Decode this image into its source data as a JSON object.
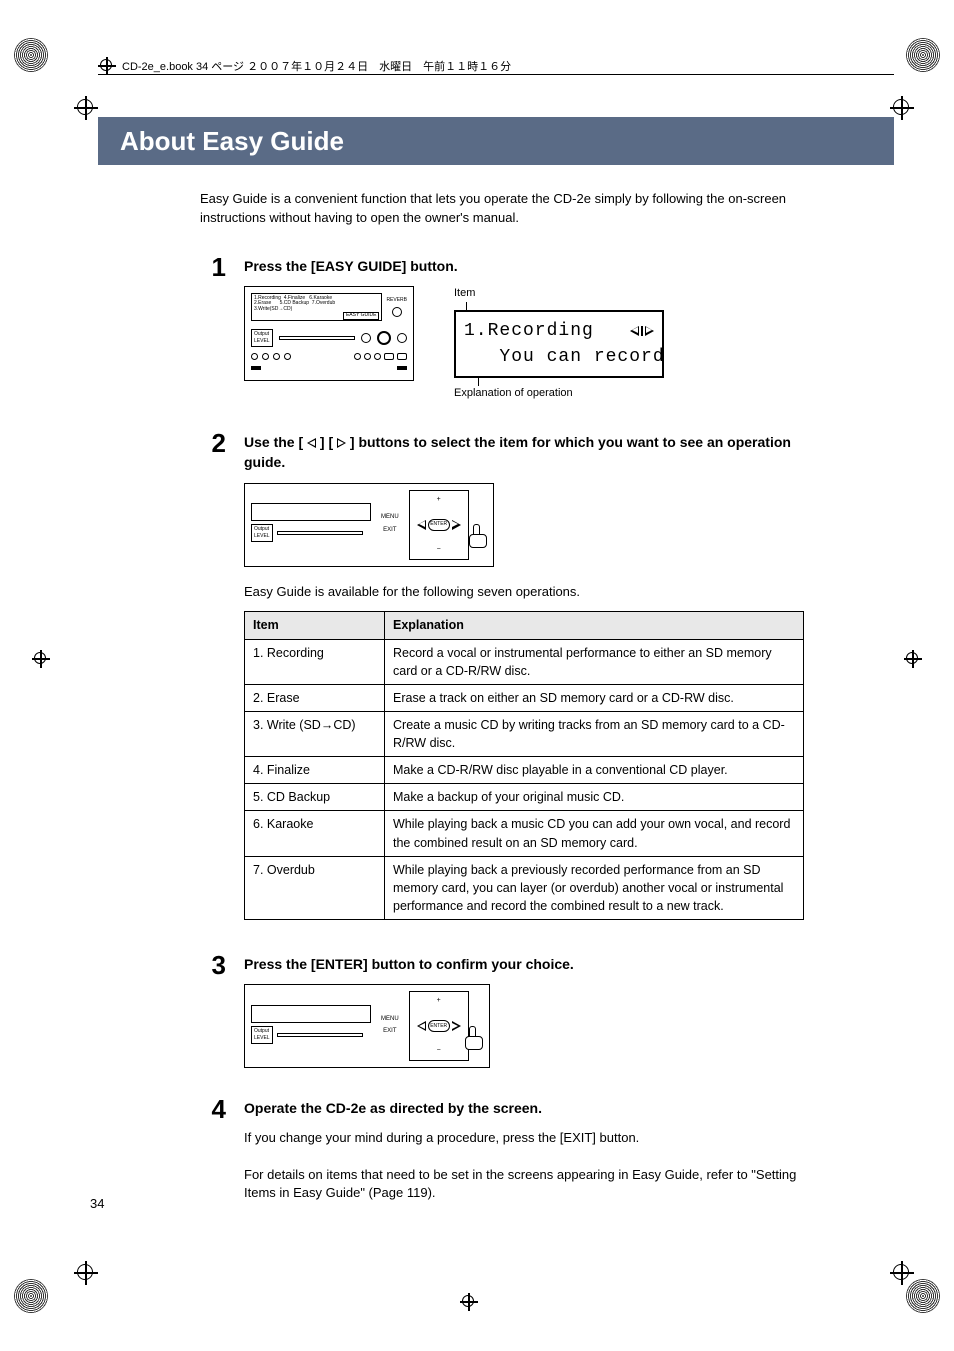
{
  "header": {
    "text": "CD-2e_e.book 34 ページ ２００７年１０月２４日　水曜日　午前１１時１６分"
  },
  "title": "About Easy Guide",
  "intro": "Easy Guide is a convenient function that lets you operate the CD-2e simply by following the on-screen instructions without having to open the owner's manual.",
  "steps": {
    "s1": {
      "num": "1",
      "head": "Press the [EASY GUIDE] button.",
      "lcd_item_label": "Item",
      "lcd_line1": "1.Recording",
      "lcd_line2": "   You can record",
      "lcd_expl_label": "Explanation of operation",
      "panel_menu_text": "1.Recording  4.Finalize   6.Karaoke\n2.Erase      5.CD Backup  7.Overdub\n3.Write(SD→CD)",
      "panel_easy_label": "EASY GUIDE",
      "panel_reverb": "REVERB"
    },
    "s2": {
      "num": "2",
      "head_pre": "Use the [",
      "head_mid": "] [",
      "head_post": "] buttons to select the item for which you want to see an operation guide.",
      "note": "Easy Guide is available for the following seven operations.",
      "btn_menu": "MENU",
      "btn_exit": "EXIT",
      "btn_enter": "ENTER"
    },
    "s3": {
      "num": "3",
      "head": "Press the [ENTER] button to confirm your choice.",
      "btn_menu": "MENU",
      "btn_exit": "EXIT",
      "btn_enter": "ENTER"
    },
    "s4": {
      "num": "4",
      "head": "Operate the CD-2e as directed by the screen.",
      "p1": "If you change your mind during a procedure, press the [EXIT] button.",
      "p2": "For details on items that need to be set in the screens appearing in Easy Guide, refer to \"Setting Items in Easy Guide\" (Page 119)."
    }
  },
  "table": {
    "head_item": "Item",
    "head_expl": "Explanation",
    "rows": [
      {
        "item": "1. Recording",
        "expl": "Record a vocal or instrumental performance to either an SD memory card or a CD-R/RW disc."
      },
      {
        "item": "2. Erase",
        "expl": "Erase a track on either an SD memory card or a CD-RW disc."
      },
      {
        "item": "3. Write (SD→CD)",
        "expl": "Create a music CD by writing tracks from an SD memory card to a CD-R/RW disc."
      },
      {
        "item": "4. Finalize",
        "expl": "Make a CD-R/RW disc playable in a conventional CD player."
      },
      {
        "item": "5. CD Backup",
        "expl": "Make a backup of your original music CD."
      },
      {
        "item": "6. Karaoke",
        "expl": "While playing back a music CD you can add your own vocal, and record the combined result on an SD memory card."
      },
      {
        "item": "7. Overdub",
        "expl": "While playing back a previously recorded performance from an SD memory card, you can layer (or overdub) another vocal or instrumental performance and record the combined result to a new track."
      }
    ]
  },
  "page_number": "34"
}
